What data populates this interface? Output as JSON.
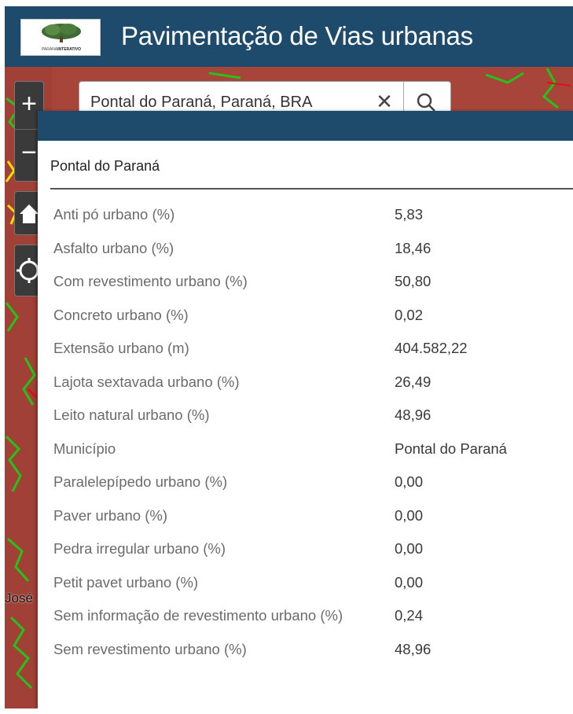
{
  "header": {
    "logo_text_prefix": "PARANÁ",
    "logo_text_suffix": "INTERATIVO",
    "title": "Pavimentação de Vias urbanas",
    "color": "#1e4a6b"
  },
  "map": {
    "label": "José",
    "base_color": "#a8453a",
    "road_color": "#22c41a",
    "controls": {
      "zoom_in": "+",
      "zoom_out": "−"
    }
  },
  "search": {
    "value": "Pontal do Paraná, Paraná, BRA",
    "clear_glyph": "✕"
  },
  "popup": {
    "title": "Pontal do Paraná",
    "rows": [
      {
        "key": "Anti pó urbano (%)",
        "value": "5,83"
      },
      {
        "key": "Asfalto urbano (%)",
        "value": "18,46"
      },
      {
        "key": "Com revestimento urbano (%)",
        "value": "50,80"
      },
      {
        "key": "Concreto urbano (%)",
        "value": "0,02"
      },
      {
        "key": "Extensão urbano (m)",
        "value": "404.582,22"
      },
      {
        "key": "Lajota sextavada urbano (%)",
        "value": "26,49"
      },
      {
        "key": "Leito natural urbano (%)",
        "value": "48,96"
      },
      {
        "key": "Município",
        "value": "Pontal do Paraná"
      },
      {
        "key": "Paralelepípedo urbano (%)",
        "value": "0,00"
      },
      {
        "key": "Paver urbano (%)",
        "value": "0,00"
      },
      {
        "key": "Pedra irregular urbano (%)",
        "value": "0,00"
      },
      {
        "key": "Petit pavet urbano (%)",
        "value": "0,00"
      },
      {
        "key": "Sem informação de revestimento urbano (%)",
        "value": "0,24"
      },
      {
        "key": "Sem revestimento urbano (%)",
        "value": "48,96"
      }
    ]
  }
}
